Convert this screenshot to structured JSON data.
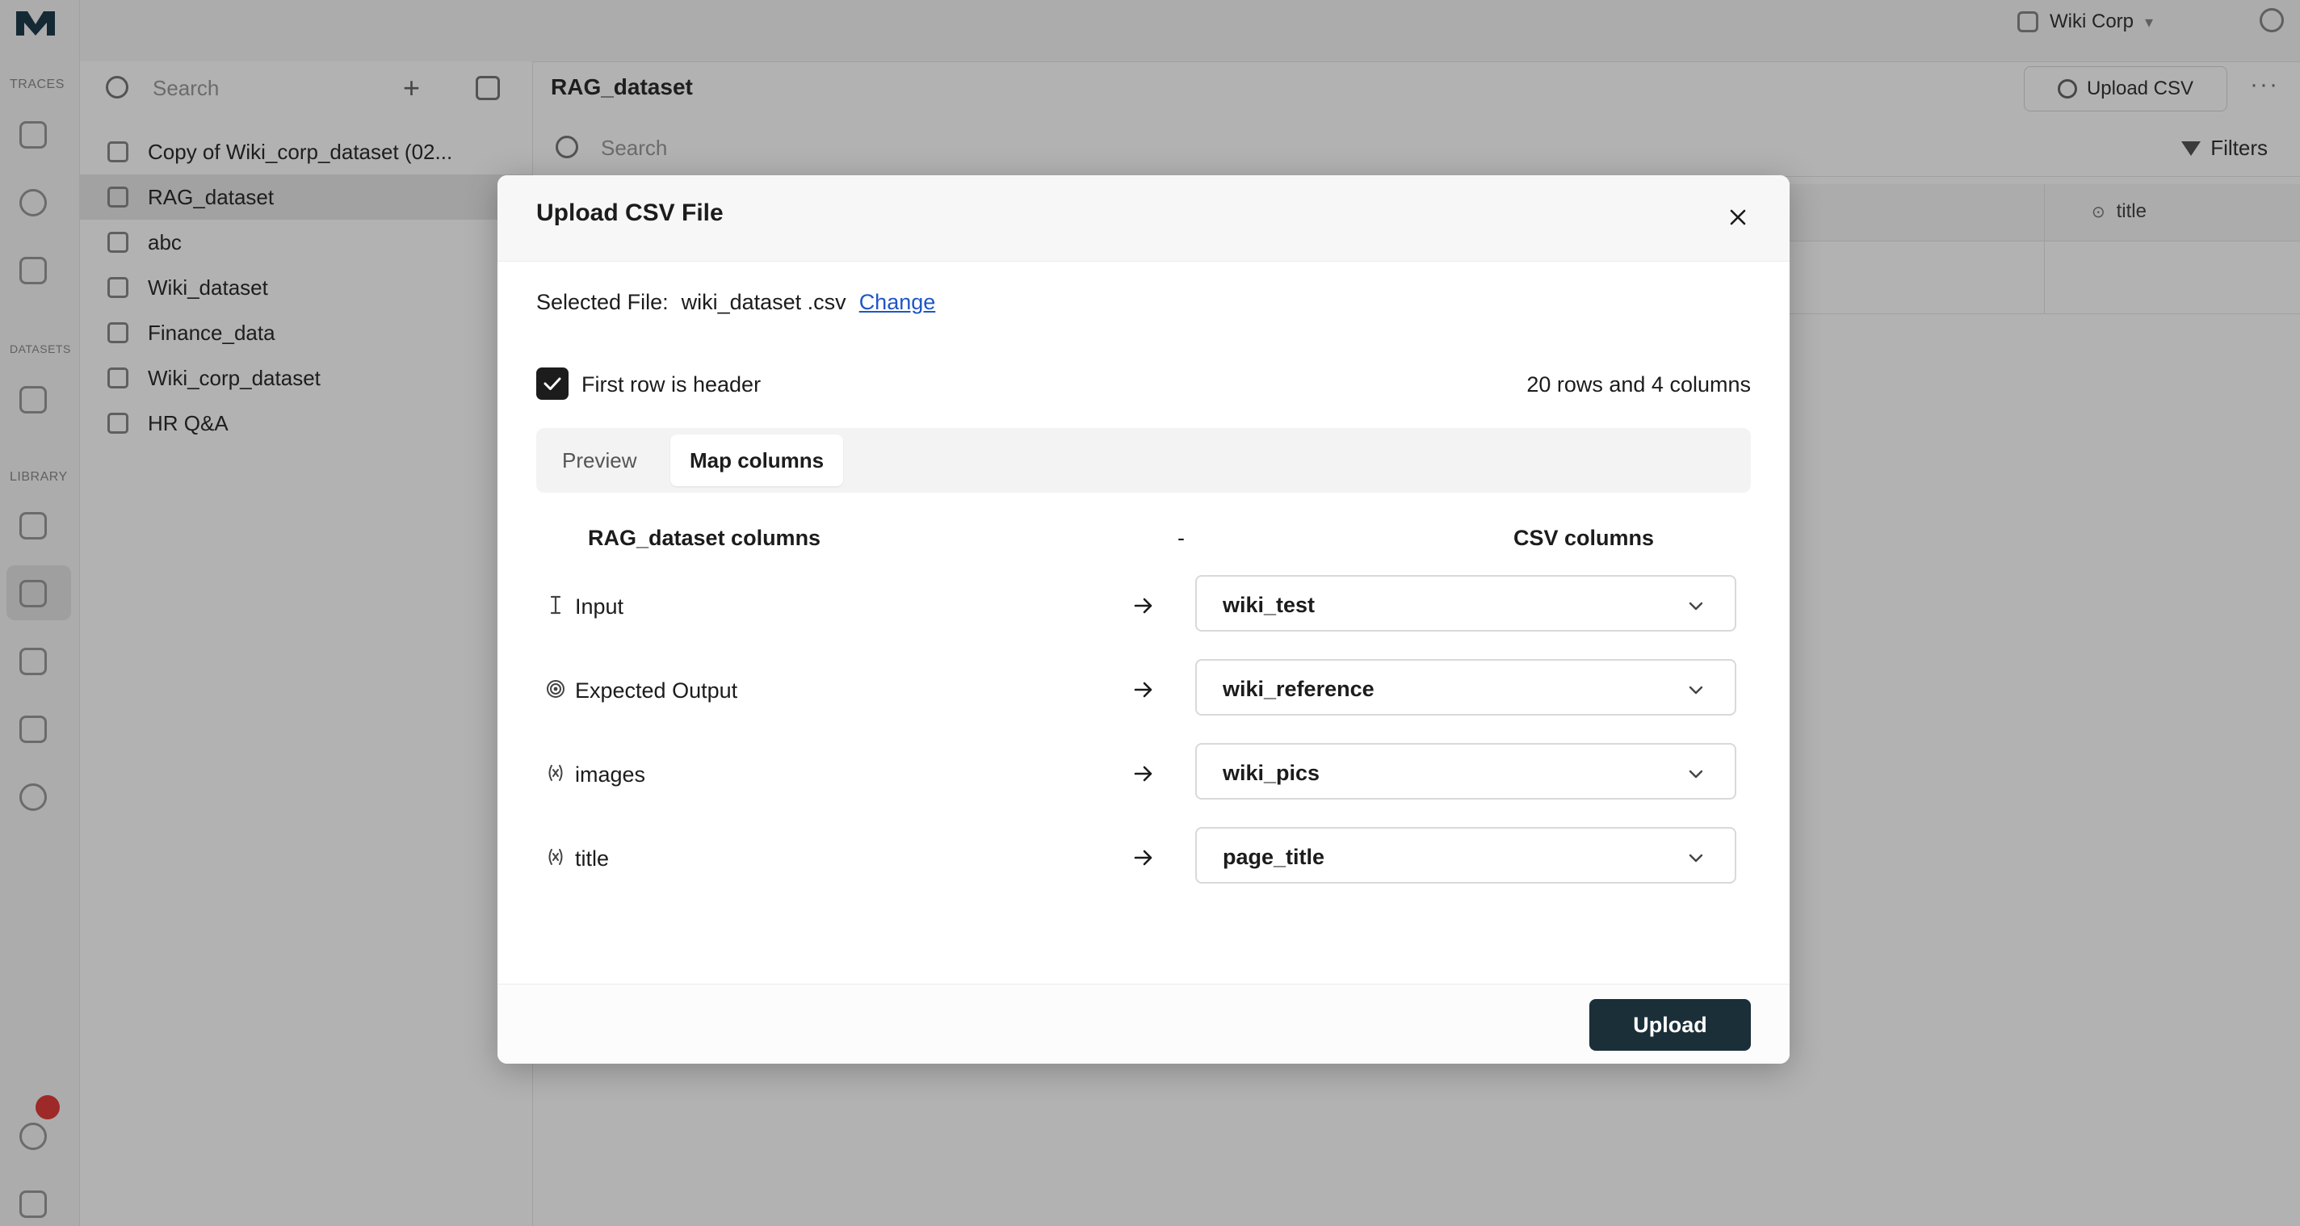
{
  "app": {
    "rail": {
      "sections": [
        "TRACES",
        "DATASETS",
        "LIBRARY"
      ]
    },
    "topbar": {
      "workspace": "Wiki Corp"
    },
    "list": {
      "search_placeholder": "Search",
      "items": [
        {
          "label": "Copy of Wiki_corp_dataset (02..."
        },
        {
          "label": "RAG_dataset"
        },
        {
          "label": "abc"
        },
        {
          "label": "Wiki_dataset"
        },
        {
          "label": "Finance_data"
        },
        {
          "label": "Wiki_corp_dataset"
        },
        {
          "label": "HR Q&A"
        }
      ]
    },
    "main": {
      "title": "RAG_dataset",
      "upload_csv": "Upload CSV",
      "search_placeholder": "Search",
      "filters": "Filters",
      "column_title": "title"
    }
  },
  "modal": {
    "title": "Upload CSV File",
    "selected_file_label": "Selected File:",
    "file_name": "wiki_dataset .csv",
    "change_label": "Change",
    "first_row_header_label": "First row is header",
    "first_row_header_checked": true,
    "row_count": "20 rows and 4 columns",
    "tabs": [
      {
        "label": "Preview",
        "active": false
      },
      {
        "label": "Map columns",
        "active": true
      }
    ],
    "mapping": {
      "left_header": "RAG_dataset columns",
      "separator": "-",
      "right_header": "CSV columns",
      "rows": [
        {
          "column": "Input",
          "type_icon": "text-cursor-icon",
          "csv_column": "wiki_test"
        },
        {
          "column": "Expected Output",
          "type_icon": "target-icon",
          "csv_column": "wiki_reference"
        },
        {
          "column": "images",
          "type_icon": "variable-icon",
          "csv_column": "wiki_pics"
        },
        {
          "column": "title",
          "type_icon": "variable-icon",
          "csv_column": "page_title"
        }
      ]
    },
    "upload_label": "Upload"
  },
  "colors": {
    "primary_button": "#1b2f38",
    "link": "#1f56c7",
    "checkbox": "#1c1c1c"
  }
}
